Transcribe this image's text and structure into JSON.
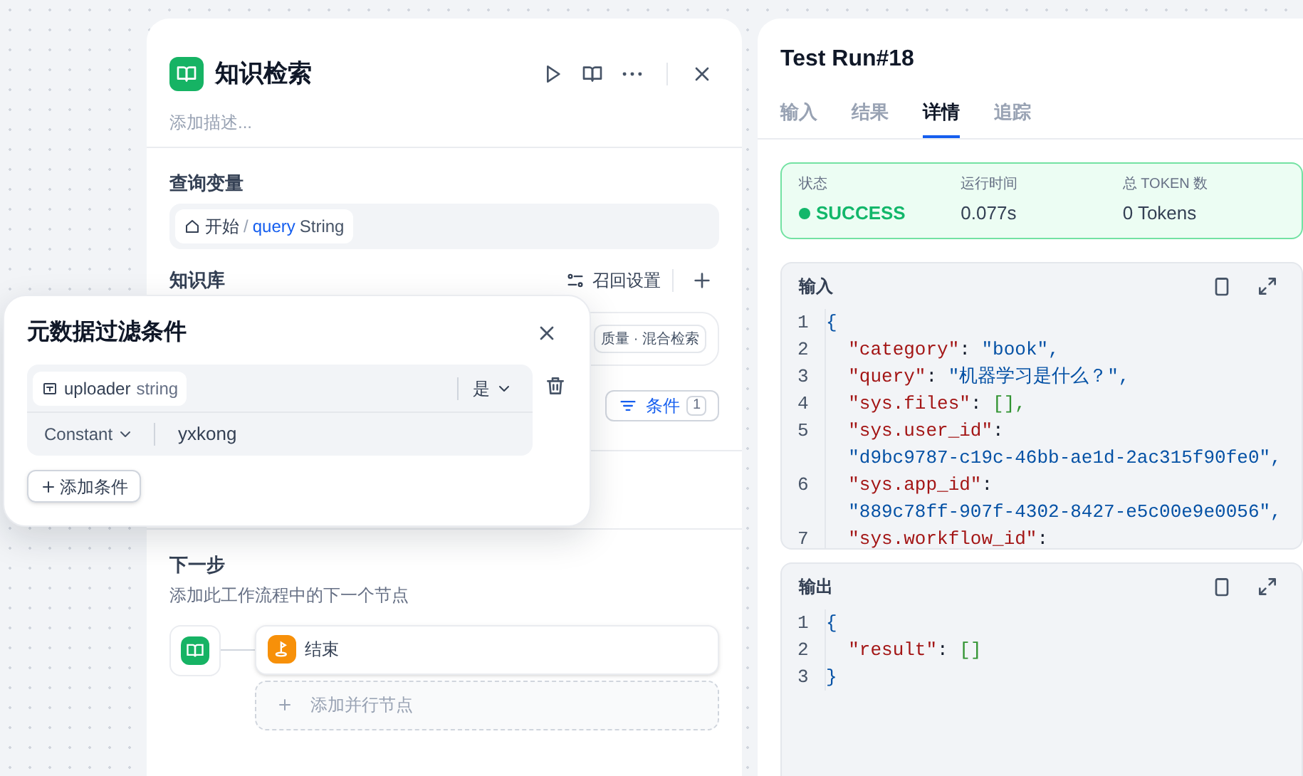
{
  "node_panel": {
    "title": "知识检索",
    "description_placeholder": "添加描述...",
    "query_variable": {
      "label": "查询变量",
      "source": "开始",
      "separator": "/",
      "variable": "query",
      "type": "String"
    },
    "knowledge_base": {
      "label": "知识库",
      "recall_settings": "召回设置",
      "tag": "质量 · 混合检索",
      "condition_button": {
        "label": "条件",
        "count": "1"
      }
    },
    "next_step": {
      "title": "下一步",
      "subtitle": "添加此工作流程中的下一个节点",
      "next_node": "结束",
      "add_parallel": "添加并行节点"
    }
  },
  "filter_popup": {
    "title": "元数据过滤条件",
    "conditions": [
      {
        "field": "uploader",
        "type": "string",
        "operator": "是",
        "value_kind": "Constant",
        "value": "yxkong"
      }
    ],
    "add_button": "添加条件"
  },
  "run_panel": {
    "title": "Test Run#18",
    "tabs": [
      {
        "label": "输入",
        "selected": false
      },
      {
        "label": "结果",
        "selected": false
      },
      {
        "label": "详情",
        "selected": true
      },
      {
        "label": "追踪",
        "selected": false
      }
    ],
    "stats": [
      {
        "label": "状态",
        "value": "SUCCESS",
        "kind": "status",
        "color": "#12b76a"
      },
      {
        "label": "运行时间",
        "value": "0.077s",
        "kind": "plain"
      },
      {
        "label": "总 TOKEN 数",
        "value": "0 Tokens",
        "kind": "plain"
      }
    ],
    "input": {
      "title": "输入",
      "lines": [
        {
          "number": "1",
          "text": "{"
        },
        {
          "number": "2",
          "text": "  \"category\": \"book\","
        },
        {
          "number": "3",
          "text": "  \"query\": \"机器学习是什么？\","
        },
        {
          "number": "4",
          "text": "  \"sys.files\": [],"
        },
        {
          "number": "5",
          "text": "  \"sys.user_id\": \"d9bc9787-c19c-46bb-ae1d-2ac315f90fe0\","
        },
        {
          "number": "6",
          "text": "  \"sys.app_id\": \"889c78ff-907f-4302-8427-e5c00e9e0056\","
        },
        {
          "number": "7",
          "text": "  \"sys.workflow_id\":"
        }
      ]
    },
    "output": {
      "title": "输出",
      "lines": [
        {
          "number": "1",
          "text": "{"
        },
        {
          "number": "2",
          "text": "  \"result\": []"
        },
        {
          "number": "3",
          "text": "}"
        }
      ]
    }
  }
}
